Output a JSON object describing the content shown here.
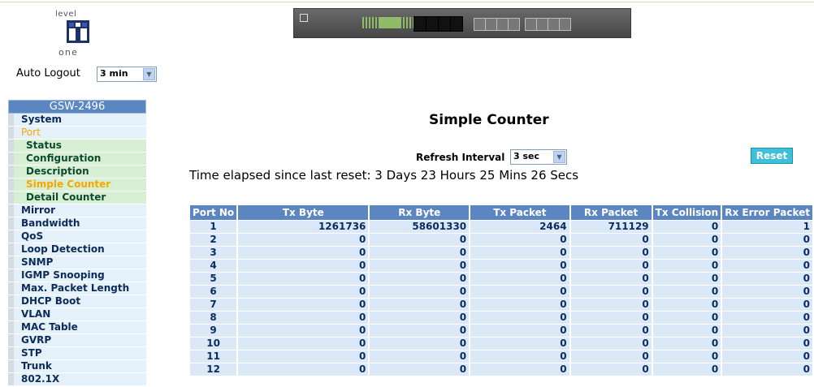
{
  "logo": {
    "word_top": "level",
    "word_bottom": "one"
  },
  "autologout": {
    "label": "Auto Logout",
    "value": "3 min"
  },
  "sidebar": {
    "header": "GSW-2496",
    "items": [
      {
        "label": "System"
      },
      {
        "label": "Port",
        "active": true
      },
      {
        "label": "Status",
        "sub": true
      },
      {
        "label": "Configuration",
        "sub": true
      },
      {
        "label": "Description",
        "sub": true
      },
      {
        "label": "Simple Counter",
        "sub": true,
        "selected": true
      },
      {
        "label": "Detail Counter",
        "sub": true
      },
      {
        "label": "Mirror"
      },
      {
        "label": "Bandwidth"
      },
      {
        "label": "QoS"
      },
      {
        "label": "Loop Detection"
      },
      {
        "label": "SNMP"
      },
      {
        "label": "IGMP Snooping"
      },
      {
        "label": "Max. Packet Length"
      },
      {
        "label": "DHCP Boot"
      },
      {
        "label": "VLAN"
      },
      {
        "label": "MAC Table"
      },
      {
        "label": "GVRP"
      },
      {
        "label": "STP"
      },
      {
        "label": "Trunk"
      },
      {
        "label": "802.1X"
      }
    ]
  },
  "main": {
    "title": "Simple Counter",
    "refresh_label": "Refresh Interval",
    "refresh_value": "3 sec",
    "reset_label": "Reset",
    "elapsed": "Time elapsed since last reset: 3 Days 23 Hours 25 Mins 26 Secs"
  },
  "table": {
    "headers": [
      "Port No",
      "Tx Byte",
      "Rx Byte",
      "Tx Packet",
      "Rx Packet",
      "Tx Collision",
      "Rx Error Packet"
    ],
    "rows": [
      [
        "1",
        "1261736",
        "58601330",
        "2464",
        "711129",
        "0",
        "1"
      ],
      [
        "2",
        "0",
        "0",
        "0",
        "0",
        "0",
        "0"
      ],
      [
        "3",
        "0",
        "0",
        "0",
        "0",
        "0",
        "0"
      ],
      [
        "4",
        "0",
        "0",
        "0",
        "0",
        "0",
        "0"
      ],
      [
        "5",
        "0",
        "0",
        "0",
        "0",
        "0",
        "0"
      ],
      [
        "6",
        "0",
        "0",
        "0",
        "0",
        "0",
        "0"
      ],
      [
        "7",
        "0",
        "0",
        "0",
        "0",
        "0",
        "0"
      ],
      [
        "8",
        "0",
        "0",
        "0",
        "0",
        "0",
        "0"
      ],
      [
        "9",
        "0",
        "0",
        "0",
        "0",
        "0",
        "0"
      ],
      [
        "10",
        "0",
        "0",
        "0",
        "0",
        "0",
        "0"
      ],
      [
        "11",
        "0",
        "0",
        "0",
        "0",
        "0",
        "0"
      ],
      [
        "12",
        "0",
        "0",
        "0",
        "0",
        "0",
        "0"
      ]
    ]
  },
  "colors": {
    "header_blue": "#5b86c2",
    "menu_bg": "#e4f1fa",
    "submenu_bg": "#d7f0d4",
    "active_orange": "#f7a600",
    "reset_cyan": "#3fbfd8"
  }
}
